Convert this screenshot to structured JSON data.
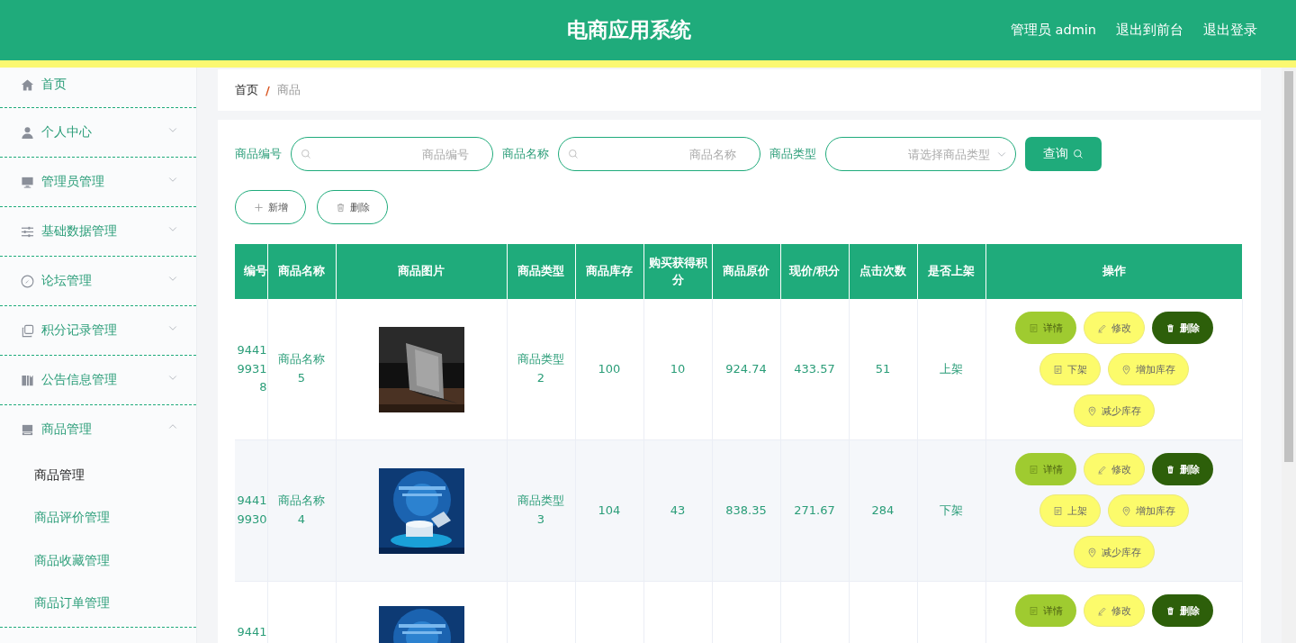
{
  "header": {
    "title": "电商应用系统",
    "user": "管理员 admin",
    "links": [
      "退出到前台",
      "退出登录"
    ]
  },
  "sidebar": {
    "items": [
      {
        "label": "首页",
        "expandable": false
      },
      {
        "label": "个人中心",
        "expandable": true,
        "expanded": false
      },
      {
        "label": "管理员管理",
        "expandable": true,
        "expanded": false
      },
      {
        "label": "基础数据管理",
        "expandable": true,
        "expanded": false
      },
      {
        "label": "论坛管理",
        "expandable": true,
        "expanded": false
      },
      {
        "label": "积分记录管理",
        "expandable": true,
        "expanded": false
      },
      {
        "label": "公告信息管理",
        "expandable": true,
        "expanded": false
      },
      {
        "label": "商品管理",
        "expandable": true,
        "expanded": true,
        "children": [
          {
            "label": "商品管理",
            "selected": true
          },
          {
            "label": "商品评价管理",
            "selected": false
          },
          {
            "label": "商品收藏管理",
            "selected": false
          },
          {
            "label": "商品订单管理",
            "selected": false
          }
        ]
      }
    ]
  },
  "breadcrumb": {
    "items": [
      "首页",
      "商品"
    ],
    "separator": "/"
  },
  "filters": [
    {
      "label": "商品编号",
      "kind": "search",
      "placeholder": "商品编号"
    },
    {
      "label": "商品名称",
      "kind": "search",
      "placeholder": "商品名称"
    },
    {
      "label": "商品类型",
      "kind": "select",
      "placeholder": "请选择商品类型"
    }
  ],
  "query_button": "查询",
  "toolbar": [
    {
      "label": "新增",
      "kind": "add"
    },
    {
      "label": "删除",
      "kind": "delete"
    }
  ],
  "table": {
    "columns": [
      "编号",
      "商品名称",
      "商品图片",
      "商品类型",
      "商品库存",
      "购买获得积分",
      "商品原价",
      "现价/积分",
      "点击次数",
      "是否上架",
      "操作"
    ],
    "rows": [
      {
        "id": "9441\n9931\n8",
        "name": "商品名称\n5",
        "type": "商品类型\n2",
        "stock": "100",
        "points": "10",
        "original_price": "924.74",
        "price": "433.57",
        "clicks": "51",
        "on_sale": "上架",
        "actions": [
          {
            "label": "详情",
            "kind": "detail"
          },
          {
            "label": "修改",
            "kind": "edit"
          },
          {
            "label": "删除",
            "kind": "delete"
          },
          {
            "label": "下架",
            "kind": "toggle"
          },
          {
            "label": "增加库存",
            "kind": "add-stock"
          },
          {
            "label": "减少库存",
            "kind": "reduce-stock"
          }
        ]
      },
      {
        "id": "9441\n9930",
        "name": "商品名称\n4",
        "type": "商品类型\n3",
        "stock": "104",
        "points": "43",
        "original_price": "838.35",
        "price": "271.67",
        "clicks": "284",
        "on_sale": "下架",
        "actions": [
          {
            "label": "详情",
            "kind": "detail"
          },
          {
            "label": "修改",
            "kind": "edit"
          },
          {
            "label": "删除",
            "kind": "delete"
          },
          {
            "label": "上架",
            "kind": "toggle"
          },
          {
            "label": "增加库存",
            "kind": "add-stock"
          },
          {
            "label": "减少库存",
            "kind": "reduce-stock"
          }
        ]
      },
      {
        "id": "9441",
        "actions": [
          {
            "label": "详情",
            "kind": "detail"
          },
          {
            "label": "修改",
            "kind": "edit"
          },
          {
            "label": "删除",
            "kind": "delete"
          }
        ]
      }
    ]
  }
}
